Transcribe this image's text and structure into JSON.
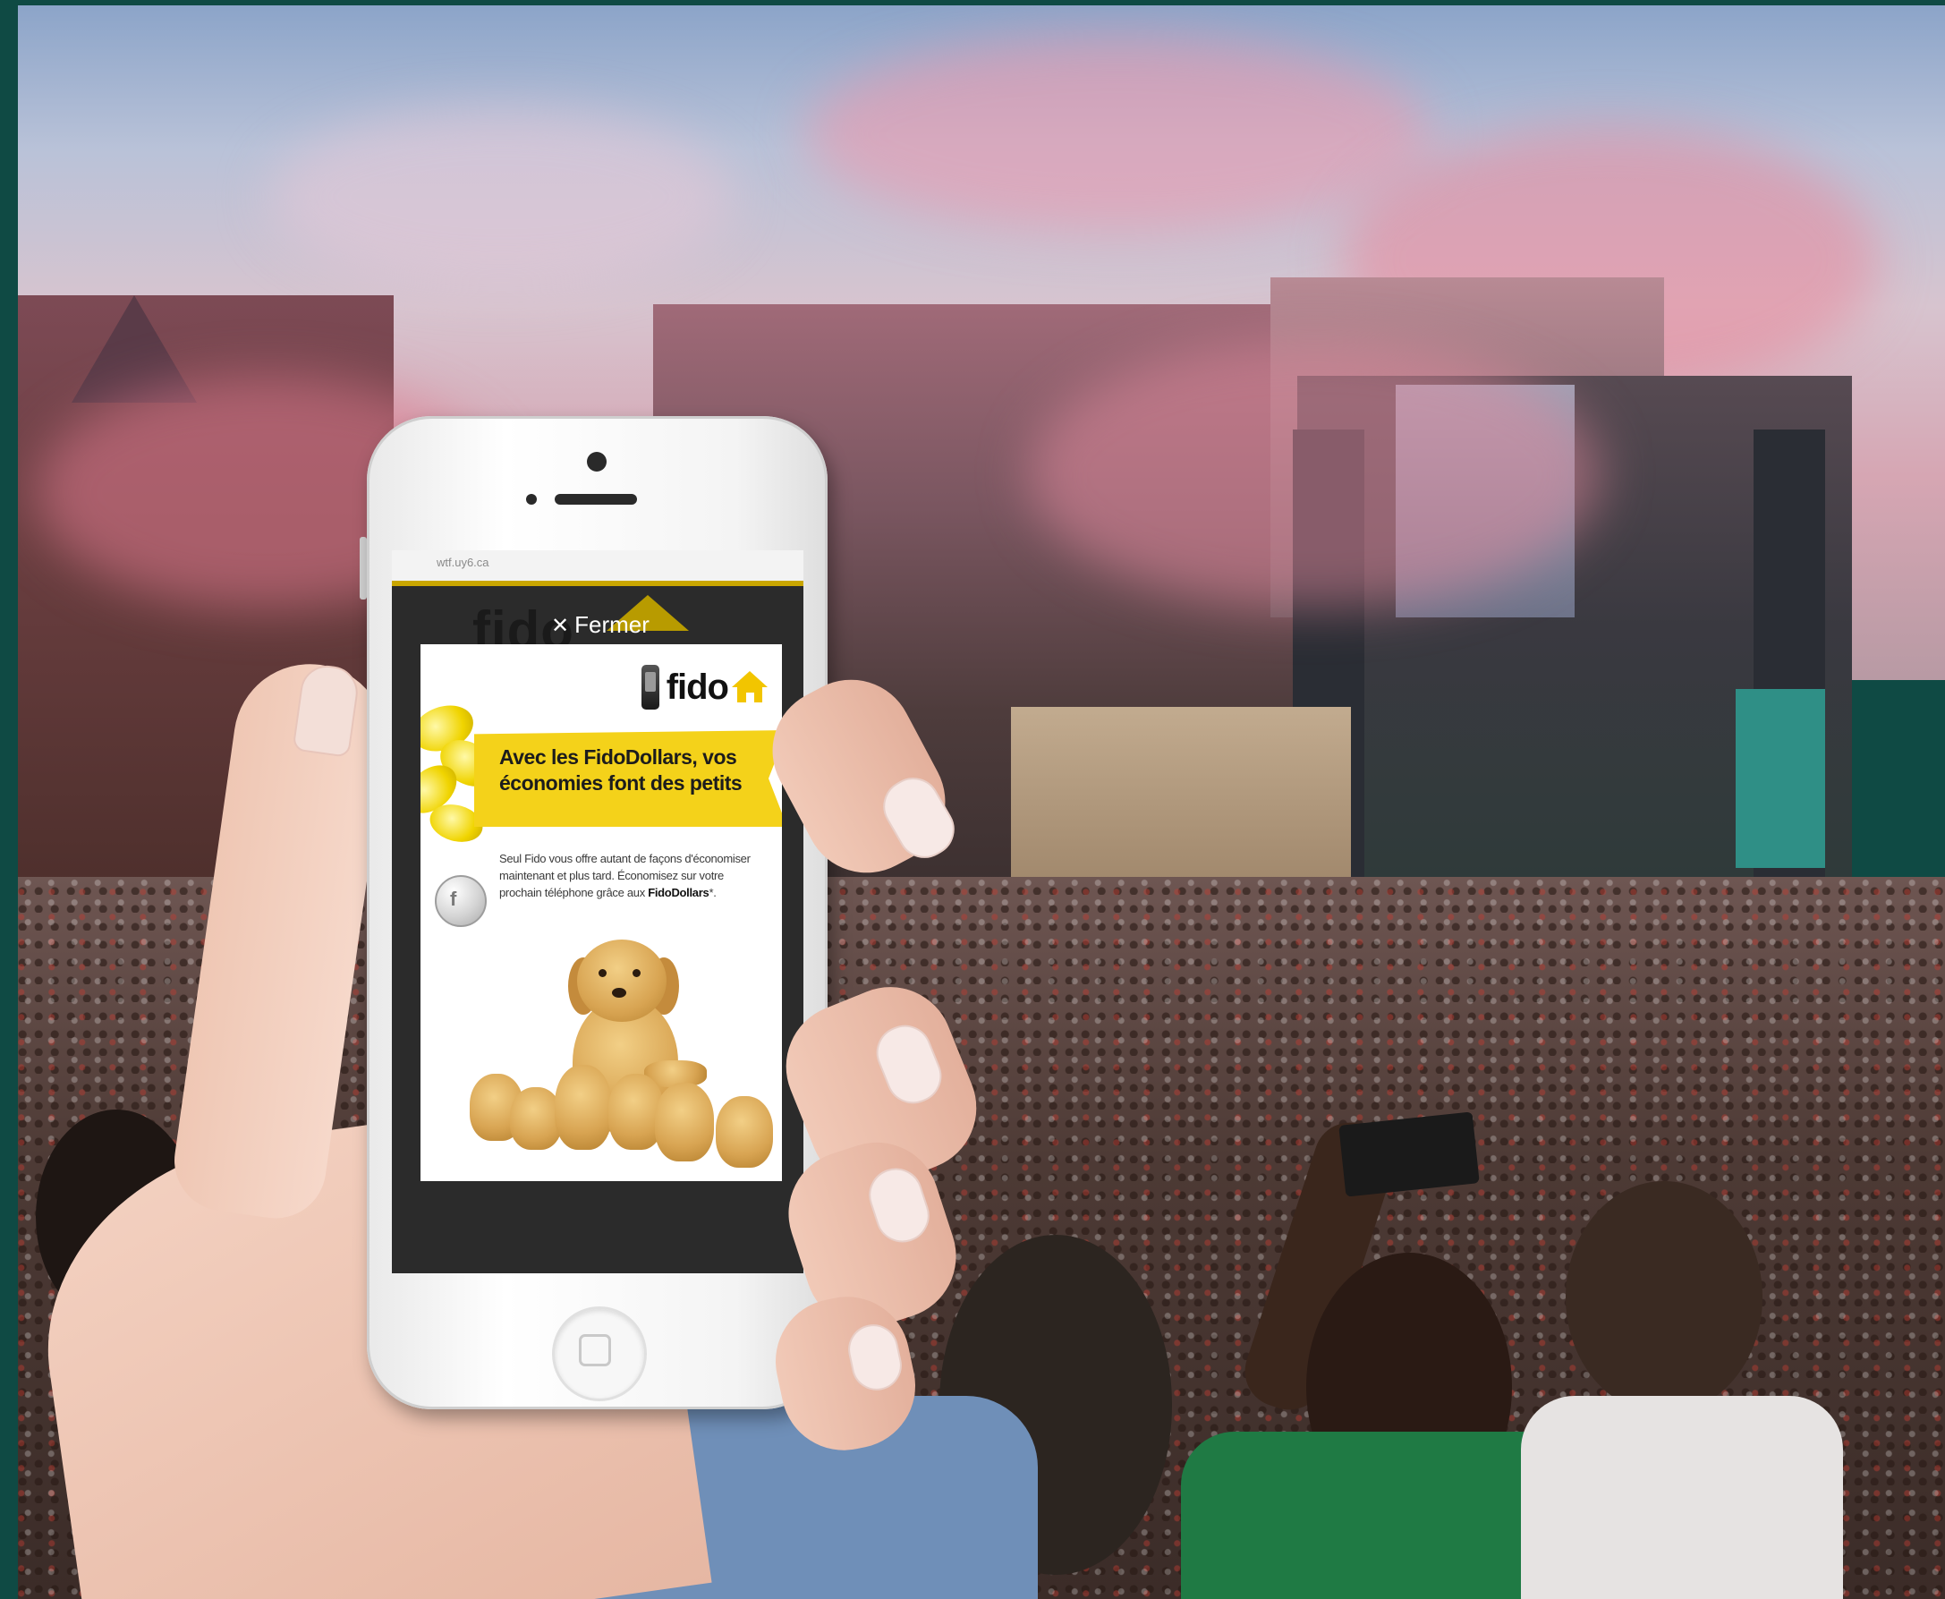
{
  "browser": {
    "url": "wtf.uy6.ca"
  },
  "overlay": {
    "close_label": "Fermer",
    "close_icon": "close-x-icon",
    "background_logo_text": "fido"
  },
  "ad": {
    "logo_text": "fido",
    "headline": "Avec les FidoDollars, vos économies font des petits",
    "body_intro": "Seul Fido vous offre autant de façons d'économiser maintenant et plus tard. Économisez sur votre prochain téléphone grâce aux ",
    "body_bold": "FidoDollars",
    "body_suffix": "*.",
    "colors": {
      "brand_yellow": "#f4d21a",
      "text_dark": "#1c1c1c"
    }
  },
  "frame": {
    "border_color": "#0f4a44"
  }
}
